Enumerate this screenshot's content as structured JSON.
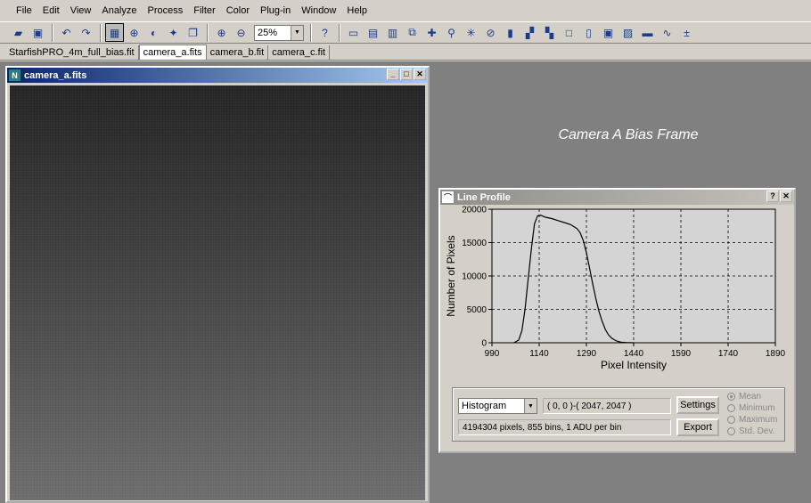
{
  "menu": [
    "File",
    "Edit",
    "View",
    "Analyze",
    "Process",
    "Filter",
    "Color",
    "Plug-in",
    "Window",
    "Help"
  ],
  "toolbar": {
    "zoom_value": "25%",
    "icons_a": [
      "open-folder-icon",
      "save-icon"
    ],
    "icons_b": [
      "undo-icon",
      "redo-icon"
    ],
    "icons_c": [
      "image-view-icon",
      "crosshair-icon",
      "flip-icon",
      "brightness-icon",
      "copy-window-icon"
    ],
    "icons_d": [
      "zoom-in-icon",
      "zoom-out-icon"
    ],
    "icons_e": [
      "help-pointer-icon"
    ],
    "icons_f": [
      "ruler-icon",
      "stack-icon",
      "align-icon",
      "duplicate-icon",
      "crosshair-plus-icon",
      "pipette-icon",
      "mark-star-icon",
      "no-sign-icon",
      "bar-chart-icon",
      "move-blocks-icon",
      "shift-blocks-icon",
      "square-icon",
      "panel-icon",
      "image-frame-icon",
      "graph-box-icon",
      "scale-bar-icon",
      "curve-icon",
      "math-icon"
    ]
  },
  "icon_glyphs": {
    "open-folder-icon": "▰",
    "save-icon": "▣",
    "undo-icon": "↶",
    "redo-icon": "↷",
    "image-view-icon": "▦",
    "crosshair-icon": "⊕",
    "flip-icon": "◐",
    "brightness-icon": "✦",
    "copy-window-icon": "❐",
    "zoom-in-icon": "⊕",
    "zoom-out-icon": "⊖",
    "help-pointer-icon": "?",
    "ruler-icon": "▭",
    "stack-icon": "▤",
    "align-icon": "▥",
    "duplicate-icon": "⧉",
    "crosshair-plus-icon": "✚",
    "pipette-icon": "⚲",
    "mark-star-icon": "✳",
    "no-sign-icon": "⊘",
    "bar-chart-icon": "▮",
    "move-blocks-icon": "▞",
    "shift-blocks-icon": "▚",
    "square-icon": "□",
    "panel-icon": "▯",
    "image-frame-icon": "▣",
    "graph-box-icon": "▨",
    "scale-bar-icon": "▬",
    "curve-icon": "∿",
    "math-icon": "±"
  },
  "tabs": [
    {
      "label": "StarfishPRO_4m_full_bias.fit",
      "active": false
    },
    {
      "label": "camera_a.fits",
      "active": true
    },
    {
      "label": "camera_b.fit",
      "active": false
    },
    {
      "label": "camera_c.fit",
      "active": false
    }
  ],
  "image_window": {
    "title": "camera_a.fits"
  },
  "caption": "Camera A Bias Frame",
  "line_profile": {
    "title": "Line Profile",
    "mode": "Histogram",
    "region": "( 0, 0 )-( 2047, 2047 )",
    "info": "4194304 pixels, 855 bins, 1 ADU per bin",
    "settings_label": "Settings",
    "export_label": "Export",
    "options": [
      {
        "label": "Mean",
        "selected": true
      },
      {
        "label": "Minimum",
        "selected": false
      },
      {
        "label": "Maximum",
        "selected": false
      },
      {
        "label": "Std. Dev.",
        "selected": false
      }
    ]
  },
  "chart_data": {
    "type": "line",
    "xlabel": "Pixel Intensity",
    "ylabel": "Number of Pixels",
    "xlim": [
      990,
      1890
    ],
    "ylim": [
      0,
      20000
    ],
    "xticks": [
      990,
      1140,
      1290,
      1440,
      1590,
      1740,
      1890
    ],
    "yticks": [
      0,
      5000,
      10000,
      15000,
      20000
    ],
    "grid": true,
    "series": [
      {
        "x": [
          1060,
          1075,
          1085,
          1095,
          1105,
          1115,
          1125,
          1135,
          1145,
          1160,
          1180,
          1200,
          1220,
          1240,
          1260,
          1270,
          1280,
          1290,
          1300,
          1310,
          1320,
          1330,
          1340,
          1350,
          1360,
          1370,
          1380,
          1390,
          1400,
          1410,
          1420,
          1430,
          1440
        ],
        "y": [
          0,
          400,
          1800,
          5000,
          9500,
          14000,
          17800,
          19000,
          19100,
          18800,
          18600,
          18300,
          18000,
          17700,
          17100,
          16500,
          15300,
          13500,
          11200,
          8800,
          6600,
          4700,
          3200,
          2000,
          1200,
          700,
          400,
          200,
          100,
          60,
          30,
          10,
          0
        ]
      }
    ]
  }
}
